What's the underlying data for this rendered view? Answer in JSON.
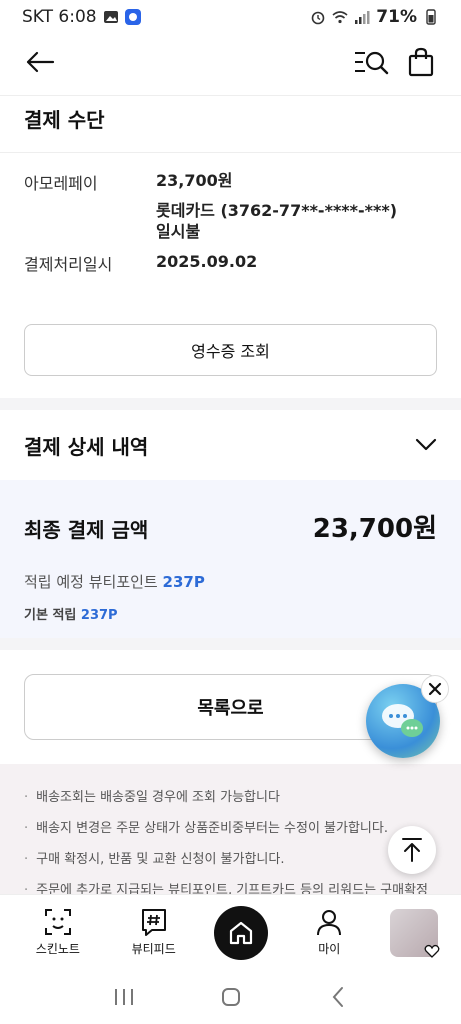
{
  "status_bar": {
    "carrier_time": "SKT 6:08",
    "battery": "71%"
  },
  "payment": {
    "section_title": "결제 수단",
    "rows": [
      {
        "label": "아모레페이",
        "lines": [
          "23,700원",
          "롯데카드 (3762-77**-****-***)",
          "일시불"
        ]
      },
      {
        "label": "결제처리일시",
        "lines": [
          "2025.09.02"
        ]
      }
    ],
    "receipt_button": "영수증 조회"
  },
  "detail": {
    "title": "결제 상세 내역",
    "final_label": "최종 결제 금액",
    "final_amount": "23,700원",
    "points_label": "적립 예정 뷰티포인트",
    "points_value": "237P",
    "basic_label": "기본 적립",
    "basic_value": "237P"
  },
  "list_button": "목록으로",
  "notices": [
    "배송조회는 배송중일 경우에 조회 가능합니다",
    "배송지 변경은 주문 상태가 상품준비중부터는 수정이 불가합니다.",
    "구매 확정시, 반품 및 교환 신청이 불가합니다.",
    "주문에 추가로 지급되는 뷰티포인트, 기프트카드 등의 리워드는 구매확정"
  ],
  "bottom_nav": {
    "skin_note": "스킨노트",
    "beauty_feed": "뷰티피드",
    "my": "마이"
  },
  "icons": [
    "back-arrow-icon",
    "search-menu-icon",
    "shopping-bag-icon",
    "chevron-down-icon",
    "chat-icon",
    "close-icon",
    "arrow-up-icon",
    "face-scan-icon",
    "hashtag-icon",
    "home-icon",
    "person-icon",
    "heart-icon"
  ],
  "colors": {
    "accent_blue": "#2d6bd6",
    "summary_bg": "#f4f6fd",
    "notice_bg": "#f5f1f3"
  }
}
